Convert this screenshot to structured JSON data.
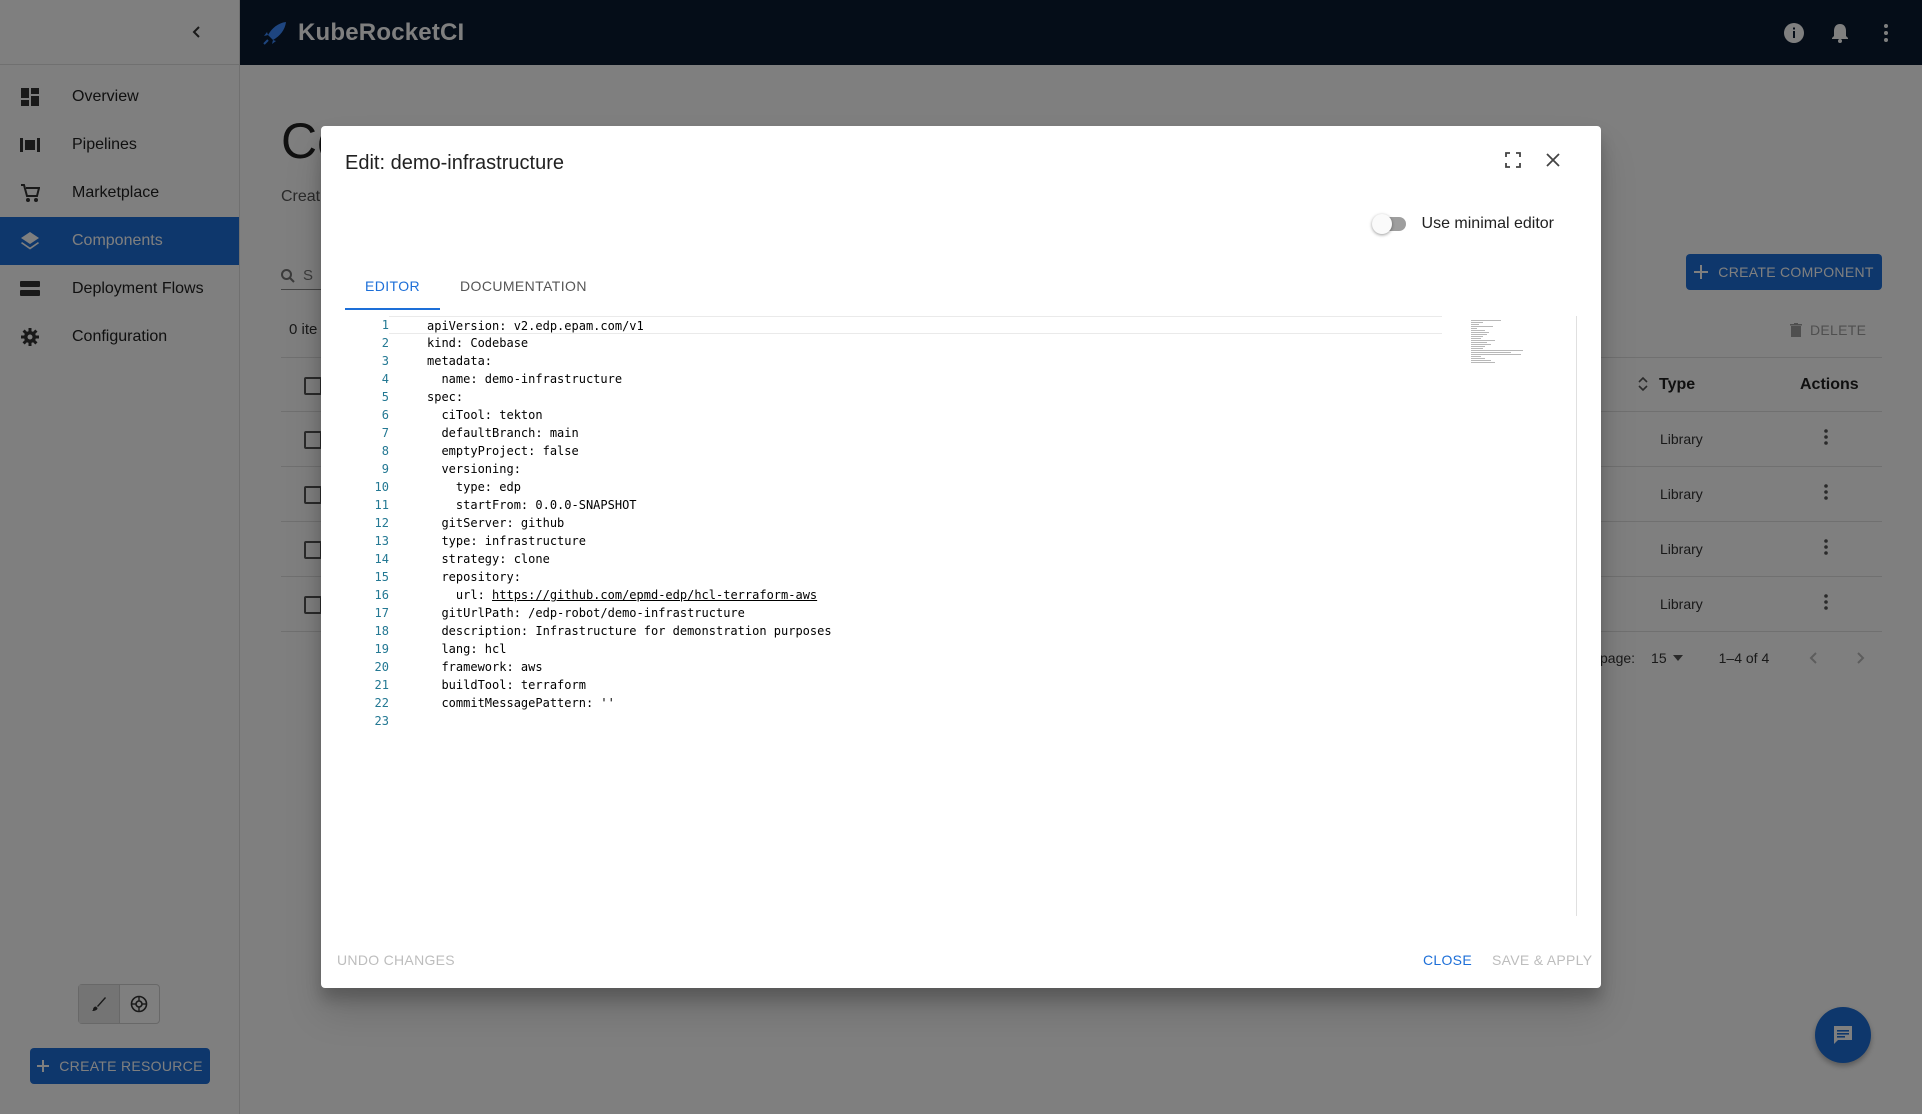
{
  "app": {
    "name": "KubeRocketCI"
  },
  "sidebar": {
    "items": [
      {
        "label": "Overview",
        "icon": "dashboard-icon"
      },
      {
        "label": "Pipelines",
        "icon": "pipelines-icon"
      },
      {
        "label": "Marketplace",
        "icon": "cart-icon"
      },
      {
        "label": "Components",
        "icon": "layers-icon",
        "active": true
      },
      {
        "label": "Deployment Flows",
        "icon": "storage-icon"
      },
      {
        "label": "Configuration",
        "icon": "gear-icon"
      }
    ],
    "create_resource_label": "CREATE RESOURCE"
  },
  "page": {
    "title": "Co",
    "subtitle": "Creat",
    "search_placeholder": "S",
    "create_component_label": "CREATE COMPONENT",
    "items_count": "0 ite",
    "delete_label": "DELETE",
    "table": {
      "headers": {
        "type": "Type",
        "actions": "Actions"
      },
      "rows": [
        {
          "type": "Library"
        },
        {
          "type": "Library"
        },
        {
          "type": "Library"
        },
        {
          "type": "Library"
        }
      ]
    },
    "pager": {
      "rows_label": "page:",
      "rows_value": "15",
      "range": "1–4 of 4"
    }
  },
  "dialog": {
    "title": "Edit: demo-infrastructure",
    "minimal_editor_label": "Use minimal editor",
    "minimal_editor_on": false,
    "tabs": [
      {
        "label": "EDITOR",
        "active": true
      },
      {
        "label": "DOCUMENTATION",
        "active": false
      }
    ],
    "editor_lines": [
      "apiVersion: v2.edp.epam.com/v1",
      "kind: Codebase",
      "metadata:",
      "  name: demo-infrastructure",
      "spec:",
      "  ciTool: tekton",
      "  defaultBranch: main",
      "  emptyProject: false",
      "  versioning:",
      "    type: edp",
      "    startFrom: 0.0.0-SNAPSHOT",
      "  gitServer: github",
      "  type: infrastructure",
      "  strategy: clone",
      "  repository:",
      "    url: https://github.com/epmd-edp/hcl-terraform-aws",
      "  gitUrlPath: /edp-robot/demo-infrastructure",
      "  description: Infrastructure for demonstration purposes",
      "  lang: hcl",
      "  framework: aws",
      "  buildTool: terraform",
      "  commitMessagePattern: ''",
      ""
    ],
    "undo_label": "UNDO CHANGES",
    "close_label": "CLOSE",
    "save_label": "SAVE & APPLY"
  },
  "colors": {
    "primary": "#1d6fd8",
    "appbar": "#0b1a30",
    "line_number": "#237893"
  }
}
